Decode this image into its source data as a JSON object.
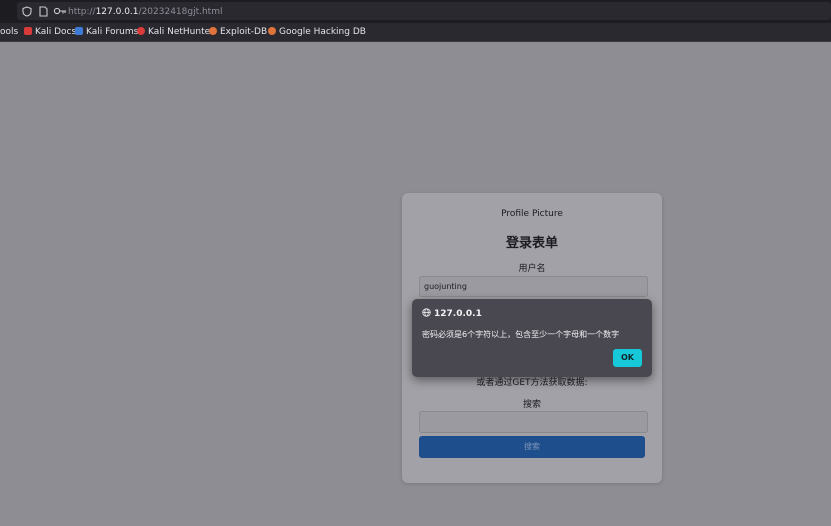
{
  "browser": {
    "url_prefix": "http://",
    "url_host": "127.0.0.1",
    "url_path": "/20232418gjt.html",
    "bookmarks": [
      {
        "label": "ools",
        "color": "#2a2930"
      },
      {
        "label": "Kali Docs",
        "color": "#d93a3a"
      },
      {
        "label": "Kali Forums",
        "color": "#3d7bd6"
      },
      {
        "label": "Kali NetHunter",
        "color": "#d93a3a"
      },
      {
        "label": "Exploit-DB",
        "color": "#e0743c"
      },
      {
        "label": "Google Hacking DB",
        "color": "#e0743c"
      }
    ]
  },
  "page": {
    "profile_picture": "Profile Picture",
    "form_title": "登录表单",
    "username_label": "用户名",
    "username_value": "guojunting",
    "get_text": "或者通过GET方法获取数据:",
    "search_label": "搜索",
    "search_button": "搜索"
  },
  "dialog": {
    "origin": "127.0.0.1",
    "message": "密码必须是6个字符以上，包含至少一个字母和一个数字",
    "ok": "OK"
  }
}
